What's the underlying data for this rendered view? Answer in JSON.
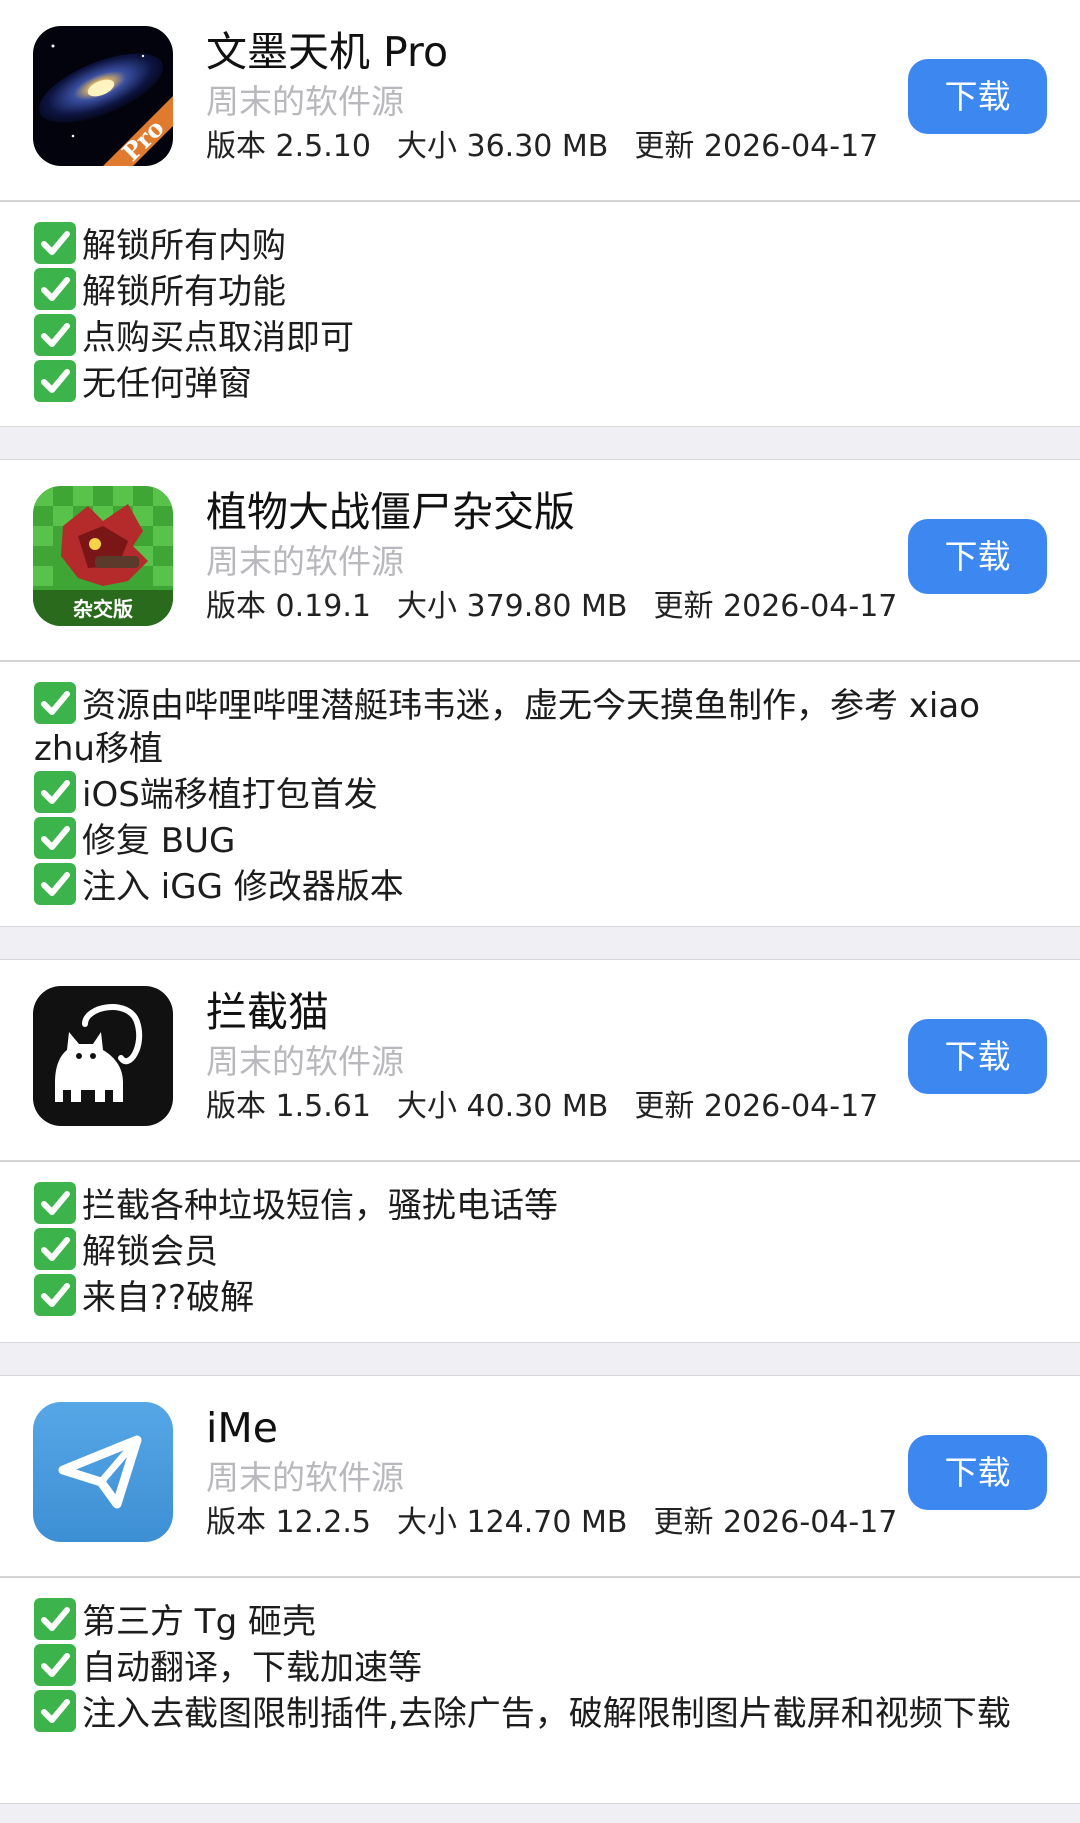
{
  "apps": [
    {
      "name": "文墨天机 Pro",
      "source": "周末的软件源",
      "version": "版本 2.5.10",
      "size": "大小 36.30 MB",
      "updated": "更新 2026-04-17",
      "button": "下载",
      "icon": "galaxy-pro-icon",
      "icon_badge": "Pro",
      "features": [
        "解锁所有内购",
        "解锁所有功能",
        "点购买点取消即可",
        "无任何弹窗"
      ]
    },
    {
      "name": "植物大战僵尸杂交版",
      "source": "周末的软件源",
      "version": "版本 0.19.1",
      "size": "大小 379.80 MB",
      "updated": "更新 2026-04-17",
      "button": "下载",
      "icon": "pvz-hybrid-icon",
      "icon_badge": "杂交版",
      "features": [
        "资源由哔哩哔哩潜艇玮韦迷，虚无今天摸鱼制作，参考 xiao zhu移植",
        "iOS端移植打包首发",
        "修复 BUG",
        "注入 iGG 修改器版本"
      ]
    },
    {
      "name": "拦截猫",
      "source": "周末的软件源",
      "version": "版本 1.5.61",
      "size": "大小 40.30 MB",
      "updated": "更新 2026-04-17",
      "button": "下载",
      "icon": "cat-icon",
      "features": [
        "拦截各种垃圾短信，骚扰电话等",
        "解锁会员",
        "来自??破解"
      ]
    },
    {
      "name": "iMe",
      "source": "周末的软件源",
      "version": "版本 12.2.5",
      "size": "大小 124.70 MB",
      "updated": "更新 2026-04-17",
      "button": "下载",
      "icon": "paper-plane-icon",
      "features": [
        "第三方 Tg 砸壳",
        "自动翻译，下载加速等",
        "注入去截图限制插件,去除广告，破解限制图片截屏和视频下载"
      ]
    }
  ],
  "colors": {
    "button": "#3c87f0",
    "check": "#3cb44b",
    "source_text": "#b8b8bd",
    "separator": "#efeff4"
  }
}
